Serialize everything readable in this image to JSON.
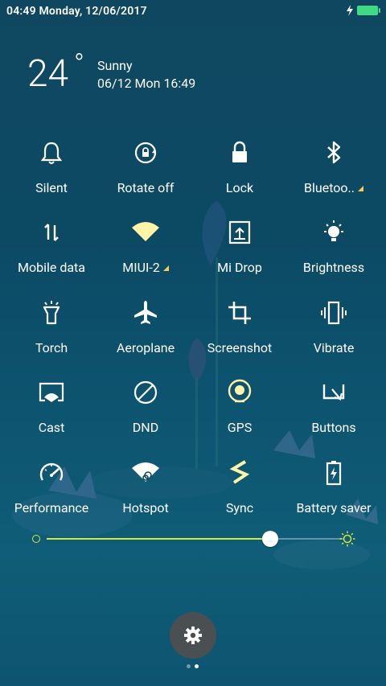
{
  "status_bar": {
    "time_date": "04:49 Monday, 12/06/2017",
    "charging_icon": "lightning-icon",
    "battery_icon": "battery-icon"
  },
  "weather": {
    "temperature": "24",
    "degree": "°",
    "condition": "Sunny",
    "datetime": "06/12 Mon 16:49"
  },
  "tiles": [
    {
      "label": "Silent",
      "icon": "bell-icon"
    },
    {
      "label": "Rotate off",
      "icon": "rotate-lock-icon"
    },
    {
      "label": "Lock",
      "icon": "lock-icon"
    },
    {
      "label": "Bluetoo..",
      "icon": "bluetooth-icon"
    },
    {
      "label": "Mobile data",
      "icon": "mobile-data-icon"
    },
    {
      "label": "MIUI-2",
      "icon": "wifi-icon"
    },
    {
      "label": "Mi Drop",
      "icon": "mi-drop-icon"
    },
    {
      "label": "Brightness",
      "icon": "brightness-icon"
    },
    {
      "label": "Torch",
      "icon": "torch-icon"
    },
    {
      "label": "Aeroplane",
      "icon": "airplane-icon"
    },
    {
      "label": "Screenshot",
      "icon": "crop-icon"
    },
    {
      "label": "Vibrate",
      "icon": "vibrate-icon"
    },
    {
      "label": "Cast",
      "icon": "cast-icon"
    },
    {
      "label": "DND",
      "icon": "dnd-icon"
    },
    {
      "label": "GPS",
      "icon": "gps-icon"
    },
    {
      "label": "Buttons",
      "icon": "buttons-icon"
    },
    {
      "label": "Performance",
      "icon": "speedometer-icon"
    },
    {
      "label": "Hotspot",
      "icon": "hotspot-icon"
    },
    {
      "label": "Sync",
      "icon": "sync-icon"
    },
    {
      "label": "Battery saver",
      "icon": "battery-saver-icon"
    }
  ],
  "brightness": {
    "level": 0.75,
    "accent": "#d7e63a"
  },
  "settings": {
    "icon": "gear-icon"
  },
  "pager": {
    "pages": 2,
    "current": 2
  },
  "colors": {
    "accent_on": "#fff3a8",
    "background": "#0c4a64"
  }
}
